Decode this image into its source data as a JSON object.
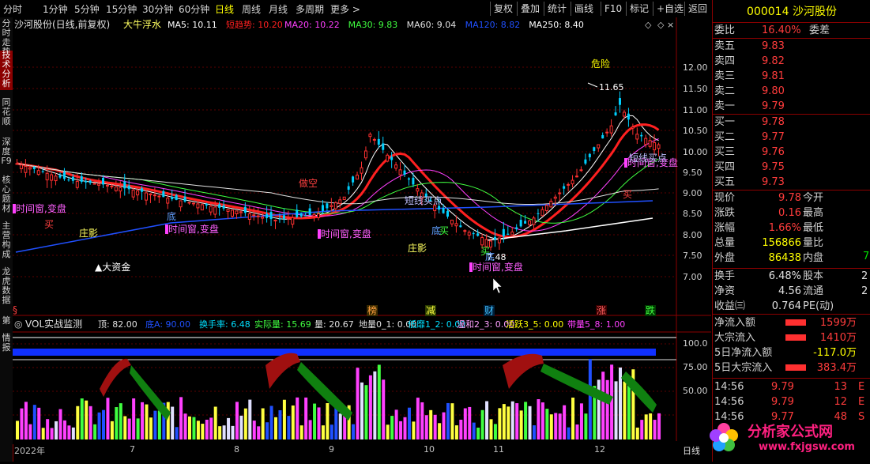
{
  "toolbar": {
    "periods": [
      "分时",
      "1分钟",
      "5分钟",
      "15分钟",
      "30分钟",
      "60分钟",
      "日线",
      "周线",
      "月线",
      "多周期",
      "更多 >"
    ],
    "active_period": "日线",
    "actions": [
      "复权",
      "叠加",
      "统计",
      "画线",
      "F10",
      "标记",
      "+自选",
      "返回"
    ]
  },
  "sidebar": {
    "tabs": [
      "分时走势",
      "技术分析",
      "同花顺",
      "深度F9",
      "核心题材",
      "主营构成",
      "龙虎数据",
      "第",
      "情报"
    ],
    "active": "技术分析"
  },
  "main_chart": {
    "stock_title": "沙河股份(日线,前复权)",
    "indicator_name": "大牛浮水",
    "ma_legend": [
      {
        "label": "MA5: 10.11",
        "color": "#ffffff"
      },
      {
        "label": "短趋势: 10.20",
        "color": "#ff2020"
      },
      {
        "label": "MA20: 10.22",
        "color": "#ff40ff"
      },
      {
        "label": "MA30: 9.83",
        "color": "#40ff40"
      },
      {
        "label": "MA60: 9.04",
        "color": "#e0e0e0"
      },
      {
        "label": "MA120: 8.82",
        "color": "#2050ff"
      },
      {
        "label": "MA250: 8.40",
        "color": "#ffffff"
      }
    ],
    "price_axis": [
      "12.00",
      "11.50",
      "11.00",
      "10.50",
      "10.00",
      "9.50",
      "9.00",
      "8.50",
      "8.00",
      "7.50",
      "7.00"
    ],
    "annotations": {
      "danger": "危险",
      "high_price": "11.65",
      "low_price": "7.48",
      "big_fund": "▲大资金",
      "window_labels": [
        "时间窗,变盘",
        "时间窗,变盘",
        "时间窗,变盘",
        "时间窗,变盘",
        "时间窗,变盘"
      ],
      "buy": "买",
      "bottom": "底",
      "zhuangying": "庄影",
      "dong_kong": "做空",
      "mai_dian": "短线买点",
      "mai_dian2": "短线买点",
      "event_tags": [
        "榜",
        "减",
        "财",
        "涨",
        "跌"
      ]
    }
  },
  "vol_panel": {
    "title": "VOL实战监测",
    "legend": [
      {
        "label": "顶: 82.00",
        "color": "#e0e0e0"
      },
      {
        "label": "底A: 90.00",
        "color": "#2050ff"
      },
      {
        "label": "换手率: 6.48",
        "color": "#00e0ff"
      },
      {
        "label": "实际量: 15.69",
        "color": "#40ff40"
      },
      {
        "label": "量: 20.67",
        "color": "#e0e0e0"
      },
      {
        "label": "地量0_1: 0.00",
        "color": "#e0e0e0"
      },
      {
        "label": "低靡1_2: 0.00",
        "color": "#00e0ff"
      },
      {
        "label": "温和2_3: 0.00",
        "color": "#ffa0ff"
      },
      {
        "label": "活跃3_5: 0.00",
        "color": "#ffff00"
      },
      {
        "label": "带量5_8: 1.00",
        "color": "#ff40ff"
      }
    ],
    "axis": [
      "100.0",
      "75.00",
      "50.00"
    ]
  },
  "bottom_axis": {
    "dates": [
      "2022年",
      "7",
      "8",
      "9",
      "10",
      "11",
      "12"
    ],
    "period": "日线"
  },
  "quote": {
    "code": "000014",
    "name": "沙河股份",
    "weibi_label": "委比",
    "weibi_value": "16.40%",
    "weicha_label": "委差",
    "asks": [
      {
        "label": "卖五",
        "price": "9.83"
      },
      {
        "label": "卖四",
        "price": "9.82"
      },
      {
        "label": "卖三",
        "price": "9.81"
      },
      {
        "label": "卖二",
        "price": "9.80"
      },
      {
        "label": "卖一",
        "price": "9.79"
      }
    ],
    "bids": [
      {
        "label": "买一",
        "price": "9.78"
      },
      {
        "label": "买二",
        "price": "9.77"
      },
      {
        "label": "买三",
        "price": "9.76"
      },
      {
        "label": "买四",
        "price": "9.75"
      },
      {
        "label": "买五",
        "price": "9.73"
      }
    ],
    "stats": [
      {
        "l1": "现价",
        "v1": "9.78",
        "l2": "今开",
        "c": "red"
      },
      {
        "l1": "涨跌",
        "v1": "0.16",
        "l2": "最高",
        "c": "red"
      },
      {
        "l1": "涨幅",
        "v1": "1.66%",
        "l2": "最低",
        "c": "red"
      },
      {
        "l1": "总量",
        "v1": "156866",
        "l2": "量比",
        "c": "yel"
      },
      {
        "l1": "外盘",
        "v1": "86438",
        "l2": "内盘",
        "c": "yel"
      }
    ],
    "neipan_value": "7",
    "stats2": [
      {
        "l1": "换手",
        "v1": "6.48%",
        "l2": "股本",
        "v2": "2"
      },
      {
        "l1": "净资",
        "v1": "4.56",
        "l2": "流通",
        "v2": "2"
      },
      {
        "l1": "收益㈢",
        "v1": "0.764",
        "l2": "PE(动)",
        "v2": ""
      }
    ],
    "flows": [
      {
        "label": "净流入额",
        "value": "1599万",
        "c": "red",
        "bar": true
      },
      {
        "label": "大宗流入",
        "value": "1410万",
        "c": "red",
        "bar": true
      },
      {
        "label": "5日净流入额",
        "value": "-117.0万",
        "c": "yel",
        "bar": false
      },
      {
        "label": "5日大宗流入",
        "value": "383.4万",
        "c": "red",
        "bar": true
      }
    ],
    "ticks": [
      {
        "time": "14:56",
        "price": "9.79",
        "vol": "13",
        "side": "E"
      },
      {
        "time": "14:56",
        "price": "9.79",
        "vol": "12",
        "side": "E"
      },
      {
        "time": "14:56",
        "price": "9.77",
        "vol": "48",
        "side": "S"
      }
    ]
  },
  "watermark": {
    "text": "分析家公式网",
    "url": "www.fxjgsw.com"
  }
}
